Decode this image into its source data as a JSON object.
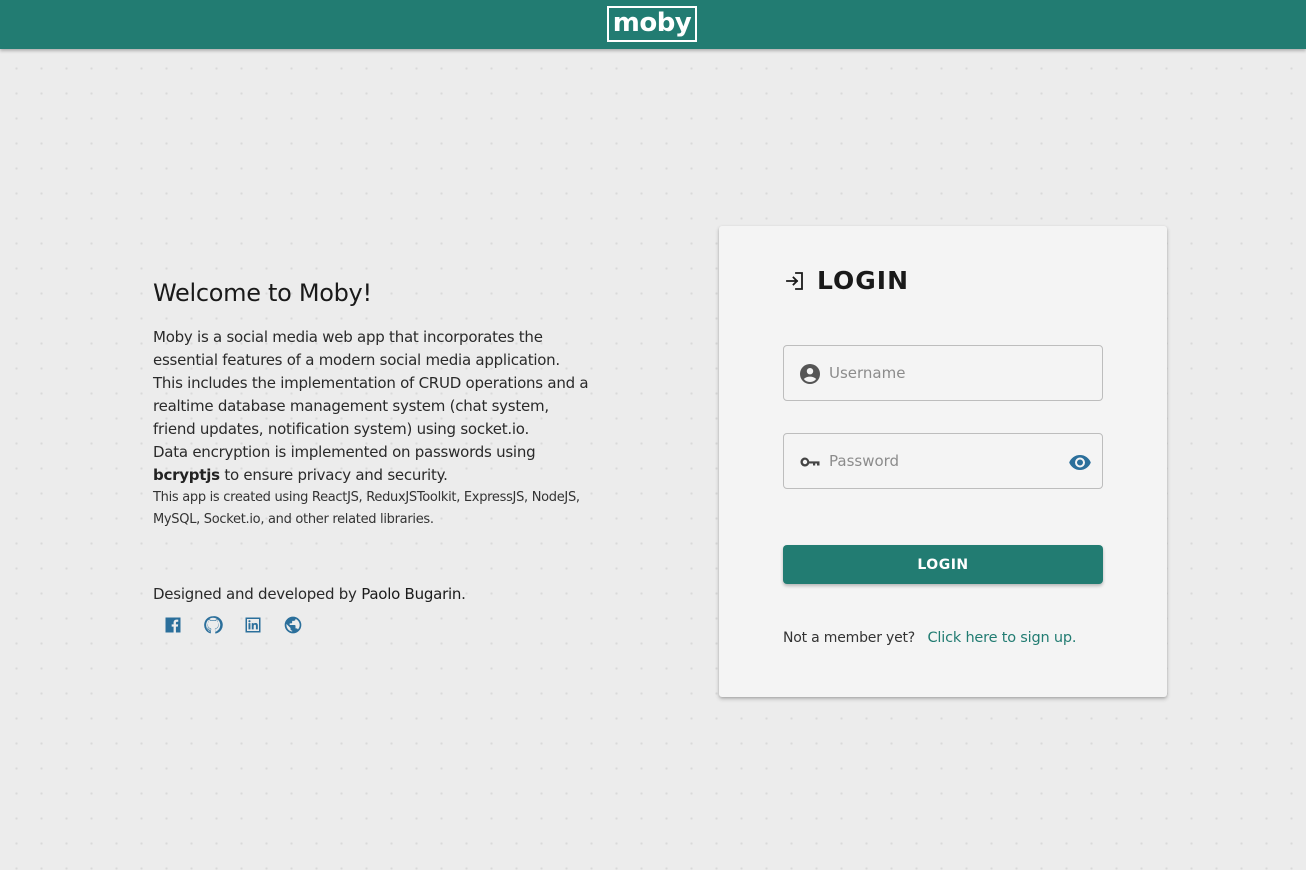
{
  "header": {
    "logo_text": "moby",
    "bg_color": "#227c72"
  },
  "intro": {
    "title": "Welcome to Moby!",
    "description_1": "Moby is a social media web app that incorporates the essential features of a modern social media application. This includes the implementation of CRUD operations and a realtime database management system (chat system, friend updates, notification system) using socket.io.",
    "description_2_prefix": "Data encryption is implemented on passwords using ",
    "description_2_bold": "bcryptjs",
    "description_2_suffix": " to ensure privacy and security.",
    "tech_note": "This app is created using ReactJS, ReduxJSToolkit, ExpressJS, NodeJS, MySQL, Socket.io, and other related libraries.",
    "credit_prefix": "Designed and developed by ",
    "credit_name": "Paolo Bugarin",
    "credit_suffix": ".",
    "socials": [
      {
        "icon": "facebook-icon"
      },
      {
        "icon": "github-icon"
      },
      {
        "icon": "linkedin-icon"
      },
      {
        "icon": "globe-icon"
      }
    ],
    "social_color": "#2b6f9b"
  },
  "login": {
    "title": "LOGIN",
    "title_icon": "login-arrow-icon",
    "username_placeholder": "Username",
    "username_icon": "account-circle-icon",
    "password_placeholder": "Password",
    "password_icon": "key-icon",
    "password_toggle_icon": "eye-icon",
    "submit_label": "LOGIN",
    "signup_question": "Not a member yet?",
    "signup_link": "Click here to sign up."
  }
}
